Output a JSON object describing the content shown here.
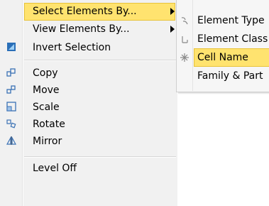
{
  "context_menu": {
    "items": [
      {
        "label": "Select Elements By...",
        "icon": "",
        "has_submenu": true,
        "highlighted": true
      },
      {
        "label": "View Elements By...",
        "icon": "",
        "has_submenu": true
      },
      {
        "label": "Invert Selection",
        "icon": "invert-selection-icon"
      },
      {
        "label": "Copy",
        "icon": "copy-icon"
      },
      {
        "label": "Move",
        "icon": "move-icon"
      },
      {
        "label": "Scale",
        "icon": "scale-icon"
      },
      {
        "label": "Rotate",
        "icon": "rotate-icon"
      },
      {
        "label": "Mirror",
        "icon": "mirror-icon"
      },
      {
        "label": "Level Off",
        "icon": ""
      }
    ]
  },
  "submenu": {
    "items": [
      {
        "label": "Element Type",
        "icon": "element-type-icon"
      },
      {
        "label": "Element Class",
        "icon": "element-class-icon"
      },
      {
        "label": "Cell Name",
        "icon": "cell-name-icon",
        "highlighted": true
      },
      {
        "label": "Family & Part",
        "icon": ""
      }
    ]
  },
  "colors": {
    "highlight": "#ffe36f",
    "highlight_border": "#e8c33a",
    "menu_background": "#f1f1f1"
  }
}
